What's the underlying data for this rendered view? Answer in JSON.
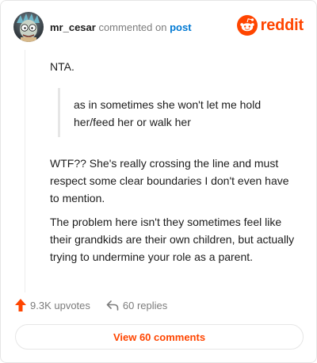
{
  "header": {
    "username": "mr_cesar",
    "action_text": "commented on",
    "link_text": "post",
    "logo_text": "reddit",
    "avatar_icon": "cartoon-avatar-icon"
  },
  "comment": {
    "intro": "NTA.",
    "quote": "as in sometimes she won't let me hold her/feed her or walk her",
    "paragraph_1": "WTF?? She's really crossing the line and must respect some clear boundaries I don't even have to mention.",
    "paragraph_2": "The problem here isn't they sometimes feel like their grandkids are their own children, but actually trying to undermine your role as a parent."
  },
  "footer": {
    "upvotes": "9.3K upvotes",
    "replies": "60 replies",
    "view_comments": "View 60 comments"
  },
  "colors": {
    "brand": "#ff4500",
    "link": "#0079d3",
    "muted": "#7c7c7c"
  }
}
